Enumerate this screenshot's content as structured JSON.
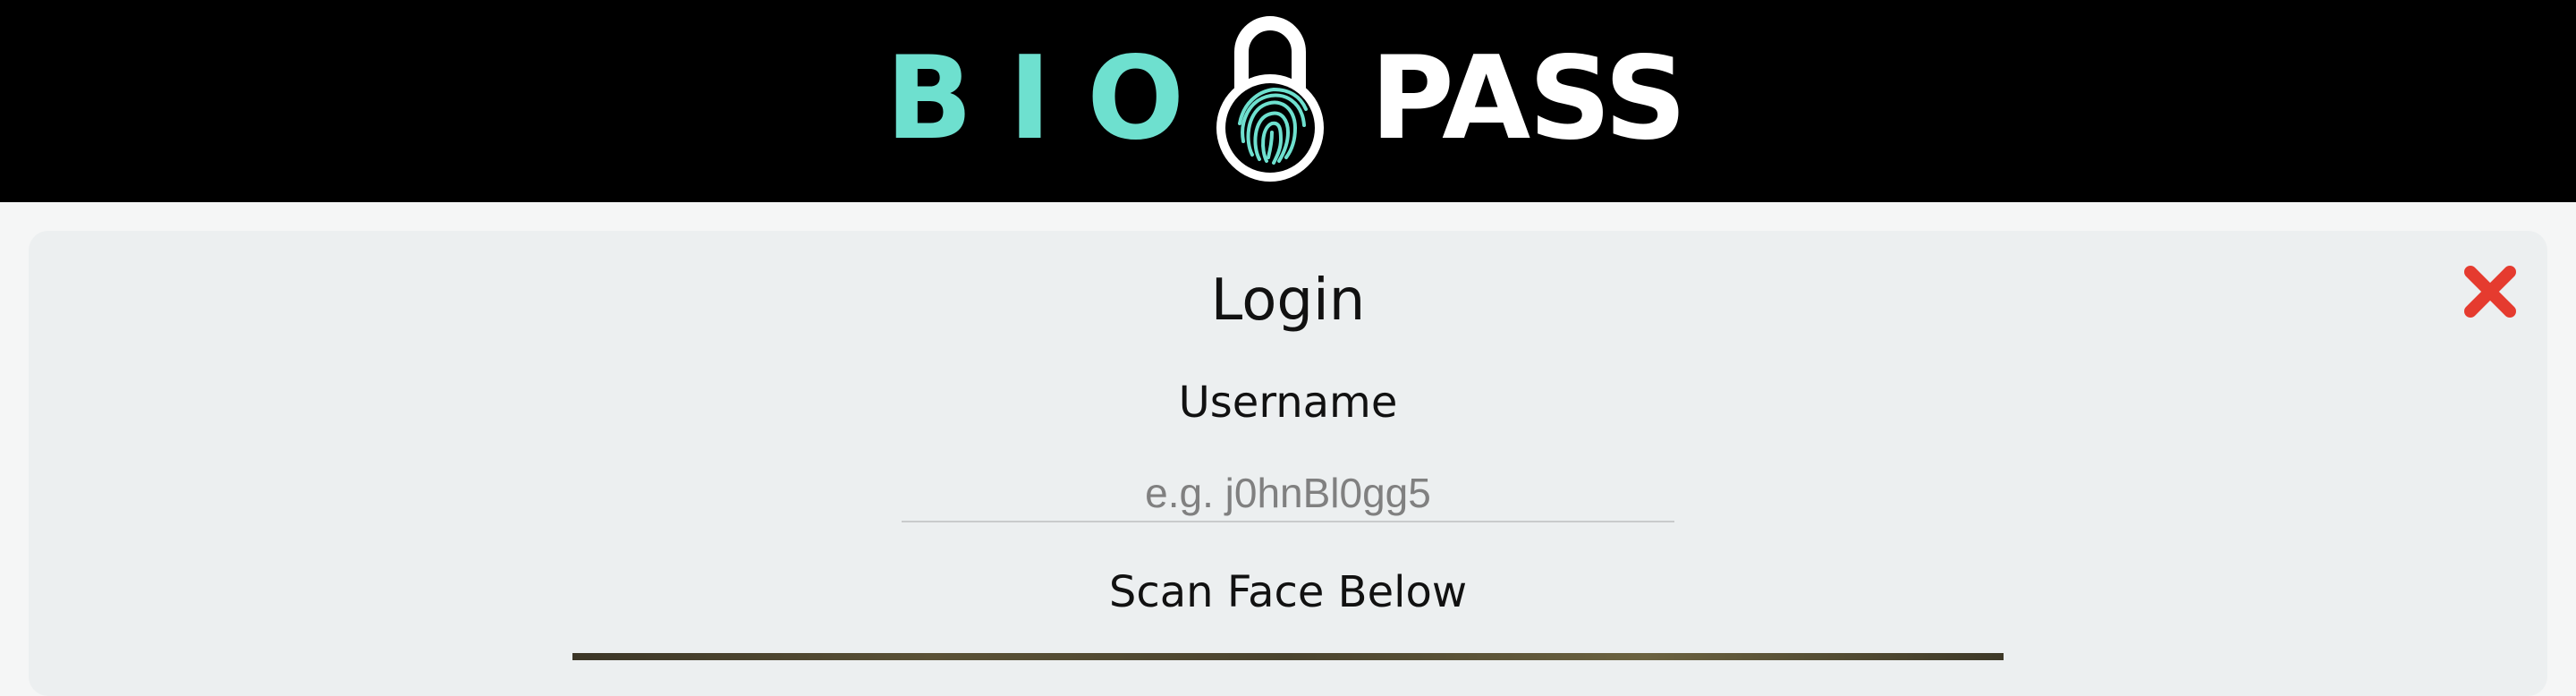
{
  "brand": {
    "word_left": "BIO",
    "word_right": "PASS",
    "colors": {
      "teal": "#6ee0cf",
      "white": "#ffffff",
      "header_bg": "#000000"
    },
    "lock_icon": "padlock-fingerprint-icon"
  },
  "login": {
    "title": "Login",
    "username_label": "Username",
    "username_placeholder": "e.g. j0hnBl0gg5",
    "username_value": "",
    "scan_label": "Scan Face Below",
    "close_icon": "close-icon",
    "close_color": "#e53b2f"
  }
}
